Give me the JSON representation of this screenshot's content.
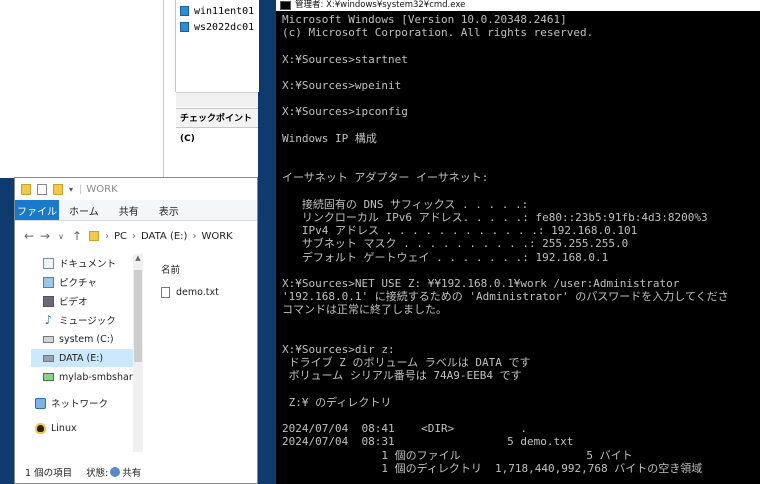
{
  "hyperv": {
    "vms": [
      "win11ent01",
      "ws2022dc01"
    ],
    "checkpoint_header": "チェックポイント(C)"
  },
  "explorer": {
    "title": "WORK",
    "tabs": {
      "file": "ファイル",
      "home": "ホーム",
      "share": "共有",
      "view": "表示"
    },
    "breadcrumb": [
      "PC",
      "DATA (E:)",
      "WORK"
    ],
    "nav_items": [
      {
        "label": "ドキュメント",
        "icon": "documents-icon"
      },
      {
        "label": "ピクチャ",
        "icon": "pictures-icon"
      },
      {
        "label": "ビデオ",
        "icon": "videos-icon"
      },
      {
        "label": "ミュージック",
        "icon": "music-icon"
      },
      {
        "label": "system (C:)",
        "icon": "drive-icon"
      },
      {
        "label": "DATA (E:)",
        "icon": "drive-icon"
      },
      {
        "label": "mylab-smbshare",
        "icon": "network-drive-icon"
      },
      {
        "label": "ネットワーク",
        "icon": "network-icon"
      },
      {
        "label": "Linux",
        "icon": "linux-icon"
      }
    ],
    "column_name": "名前",
    "files": [
      "demo.txt"
    ],
    "status": {
      "count": "1 個の項目",
      "state_label": "状態:",
      "state_value": "共有"
    }
  },
  "cmd": {
    "title": "管理者: X:¥windows¥system32¥cmd.exe",
    "lines": [
      "Microsoft Windows [Version 10.0.20348.2461]",
      "(c) Microsoft Corporation. All rights reserved.",
      "",
      "X:¥Sources>startnet",
      "",
      "X:¥Sources>wpeinit",
      "",
      "X:¥Sources>ipconfig",
      "",
      "Windows IP 構成",
      "",
      "",
      "イーサネット アダプター イーサネット:",
      "",
      "   接続固有の DNS サフィックス . . . . .:",
      "   リンクローカル IPv6 アドレス. . . . .: fe80::23b5:91fb:4d3:8200%3",
      "   IPv4 アドレス . . . . . . . . . . . .: 192.168.0.101",
      "   サブネット マスク . . . . . . . . . .: 255.255.255.0",
      "   デフォルト ゲートウェイ . . . . . . .: 192.168.0.1",
      "",
      "X:¥Sources>NET USE Z: ¥¥192.168.0.1¥work /user:Administrator",
      "'192.168.0.1' に接続するための 'Administrator' のパスワードを入力してくださ",
      "コマンドは正常に終了しました。",
      "",
      "",
      "X:¥Sources>dir z:",
      " ドライブ Z のボリューム ラベルは DATA です",
      " ボリューム シリアル番号は 74A9-EEB4 です",
      "",
      " Z:¥ のディレクトリ",
      "",
      "2024/07/04  08:41    <DIR>          .",
      "2024/07/04  08:31                 5 demo.txt",
      "               1 個のファイル                   5 バイト",
      "               1 個のディレクトリ  1,718,440,992,768 バイトの空き領域"
    ]
  }
}
